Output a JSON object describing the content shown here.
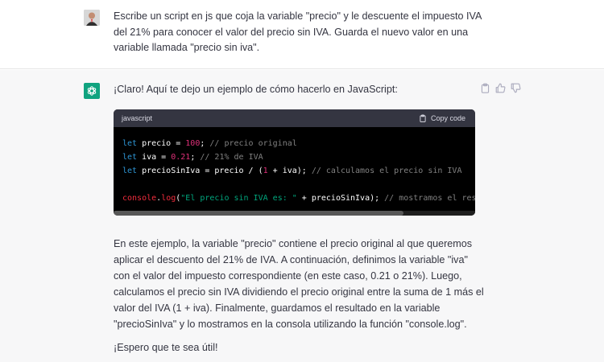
{
  "colors": {
    "assistant_bg": "#f7f7f8",
    "gpt_green": "#10a37f",
    "code_bg": "#000000",
    "code_header_bg": "#343541"
  },
  "user_message": {
    "text": "Escribe un script en js que coja la variable \"precio\" y le descuente el impuesto IVA del 21% para conocer el valor del precio sin IVA. Guarda el nuevo valor en una variable llamada \"precio sin iva\"."
  },
  "assistant_message": {
    "intro": "¡Claro! Aquí te dejo un ejemplo de cómo hacerlo en JavaScript:",
    "code_block": {
      "language": "javascript",
      "copy_label": "Copy code",
      "lines": [
        "let precio = 100; // precio original",
        "let iva = 0.21; // 21% de IVA",
        "let precioSinIva = precio / (1 + iva); // calculamos el precio sin IVA",
        "",
        "console.log(\"El precio sin IVA es: \" + precioSinIva); // mostramos el result"
      ]
    },
    "explanation": "En este ejemplo, la variable \"precio\" contiene el precio original al que queremos aplicar el descuento del 21% de IVA. A continuación, definimos la variable \"iva\" con el valor del impuesto correspondiente (en este caso, 0.21 o 21%). Luego, calculamos el precio sin IVA dividiendo el precio original entre la suma de 1 más el valor del IVA (1 + iva). Finalmente, guardamos el resultado en la variable \"precioSinIva\" y lo mostramos en la consola utilizando la función \"console.log\".",
    "closing": "¡Espero que te sea útil!",
    "action_icons": [
      "clipboard-icon",
      "thumbs-up-icon",
      "thumbs-down-icon"
    ]
  }
}
